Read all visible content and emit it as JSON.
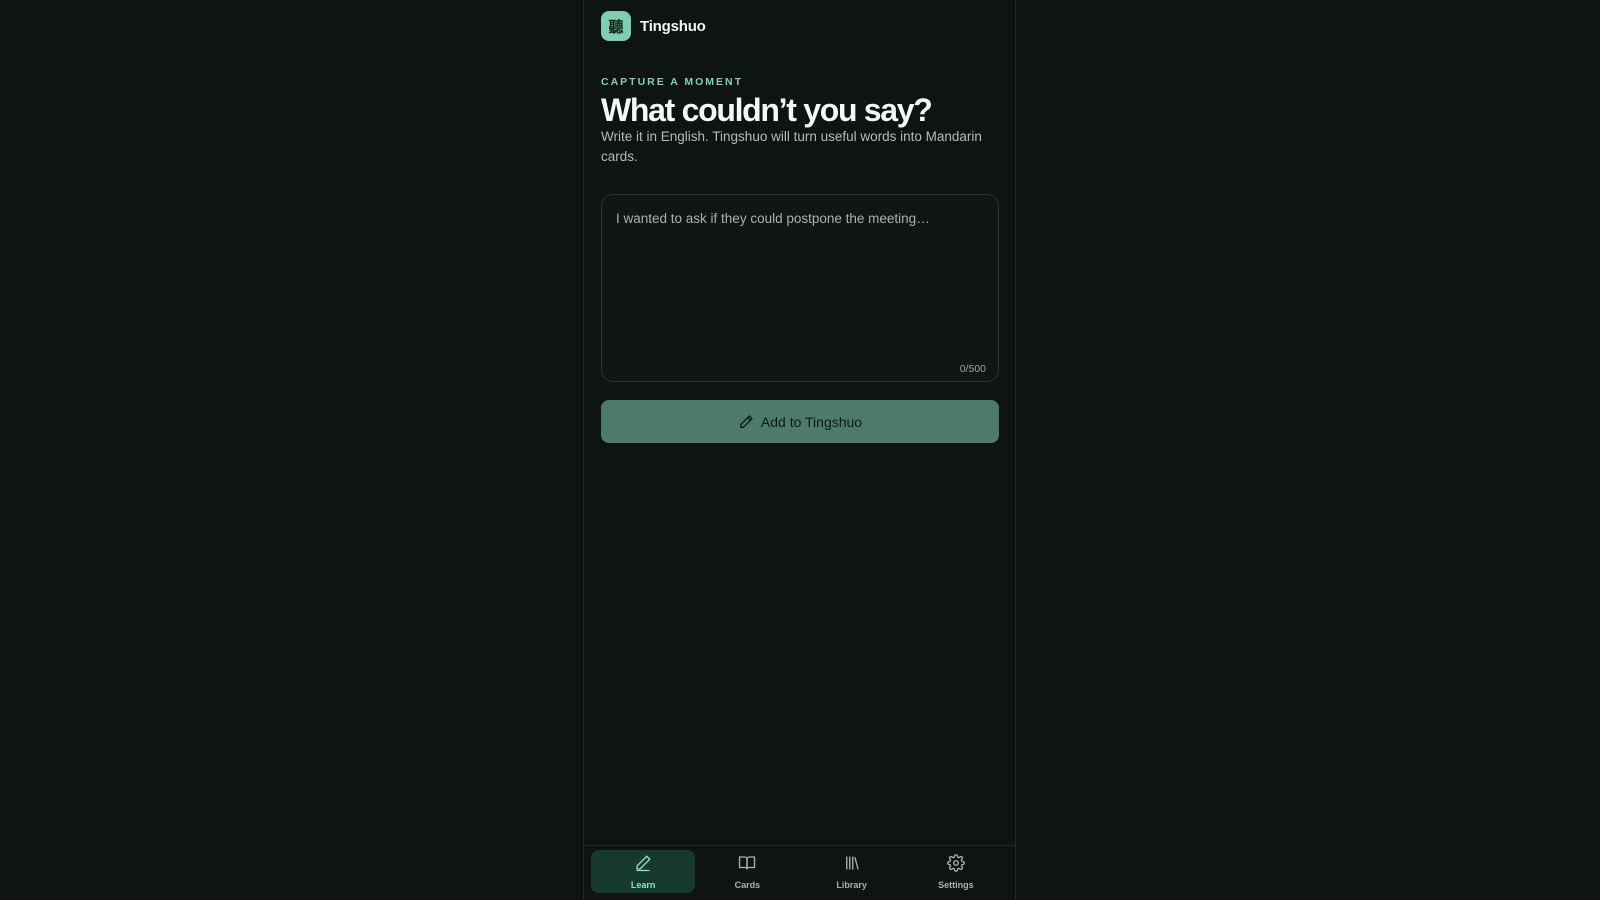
{
  "app": {
    "logo_glyph": "聽",
    "title": "Tingshuo"
  },
  "main": {
    "eyebrow": "CAPTURE A MOMENT",
    "headline": "What couldn’t you say?",
    "subtext": "Write it in English. Tingshuo will turn useful words into Mandarin cards.",
    "input_placeholder": "I wanted to ask if they could postpone the meeting…",
    "input_value": "",
    "char_counter": "0/500",
    "submit_label": "Add to Tingshuo"
  },
  "nav": {
    "items": [
      {
        "label": "Learn",
        "icon": "pencil-icon",
        "active": true
      },
      {
        "label": "Cards",
        "icon": "book-icon",
        "active": false
      },
      {
        "label": "Library",
        "icon": "library-icon",
        "active": false
      },
      {
        "label": "Settings",
        "icon": "gear-icon",
        "active": false
      }
    ]
  },
  "colors": {
    "accent": "#7fd3ae",
    "button": "#4d7a6a",
    "background": "#0e1412"
  }
}
